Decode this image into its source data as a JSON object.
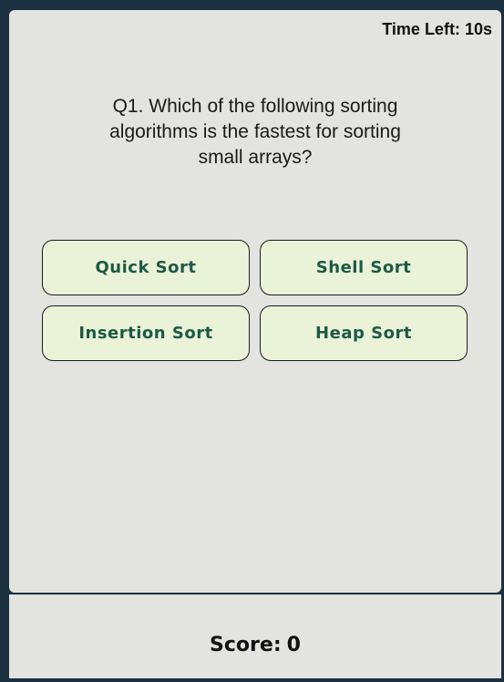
{
  "timer": {
    "label": "Time Left:",
    "value": "10s"
  },
  "question": {
    "text": "Q1. Which of the following sorting algorithms is the fastest for sorting small arrays?"
  },
  "options": [
    {
      "label": "Quick Sort"
    },
    {
      "label": "Shell Sort"
    },
    {
      "label": "Insertion Sort"
    },
    {
      "label": "Heap Sort"
    }
  ],
  "score": {
    "label": "Score:",
    "value": "0"
  },
  "colors": {
    "background": "#1b3140",
    "card": "#e3e3df",
    "option_bg": "#eaf2d8",
    "option_text": "#1d5a46"
  }
}
